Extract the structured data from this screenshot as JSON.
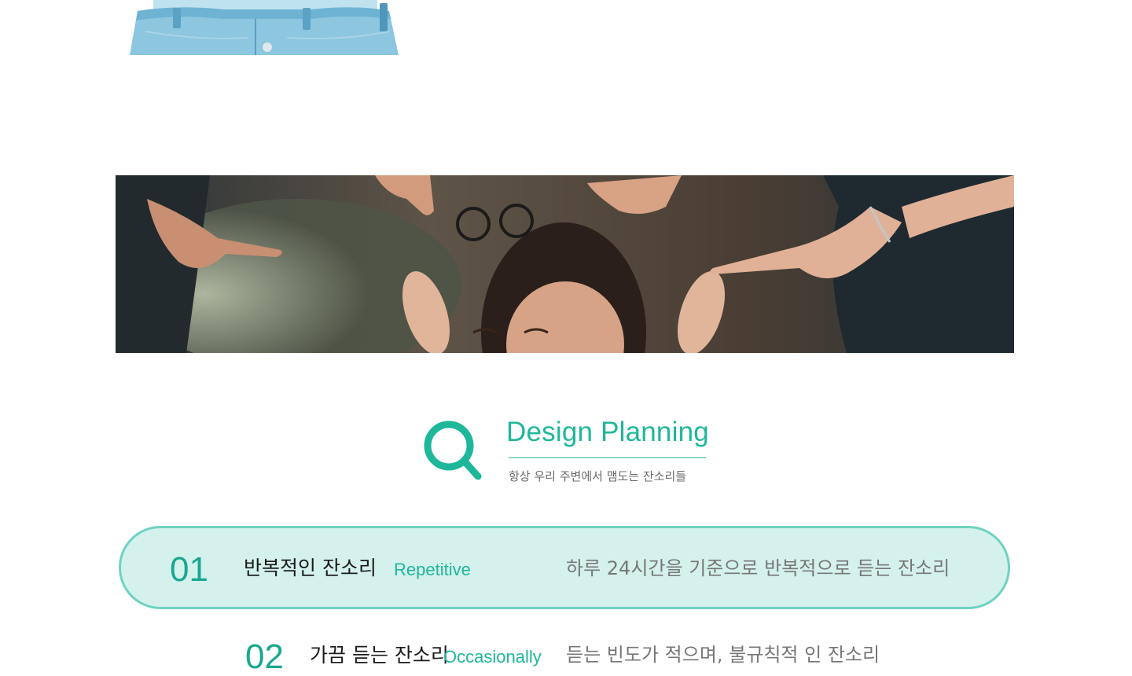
{
  "heading": {
    "title": "Design Planning",
    "subtitle": "항상 우리 주변에서 맴도는 잔소리들",
    "icon": "search-icon"
  },
  "photos": {
    "top": "person-jeans-photo",
    "banner": "stressed-woman-pointing-fingers-photo"
  },
  "items": [
    {
      "number": "01",
      "title": "반복적인 잔소리",
      "subtitle_en": "Repetitive",
      "description": "하루 24시간을 기준으로 반복적으로 듣는 잔소리",
      "active": true
    },
    {
      "number": "02",
      "title": "가끔 듣는 잔소리",
      "subtitle_en": "Occasionally",
      "description": "듣는 빈도가 적으며, 불규칙적 인 잔소리",
      "active": false
    }
  ],
  "colors": {
    "accent": "#1fb79a",
    "pill_bg": "#d4f1ec",
    "pill_border": "#6fd2c2"
  }
}
